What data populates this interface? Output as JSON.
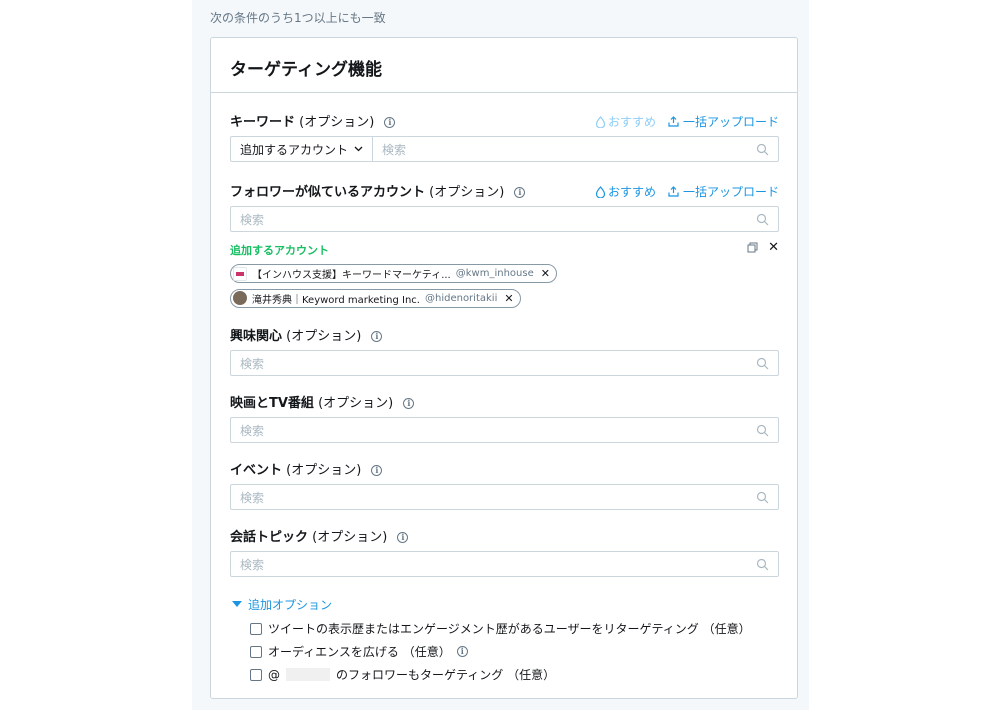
{
  "condition_text": "次の条件のうち1つ以上にも一致",
  "card": {
    "title": "ターゲティング機能"
  },
  "common": {
    "optional": "(オプション)",
    "info": "i",
    "search_placeholder": "検索",
    "recommend": "おすすめ",
    "bulk_upload": "一括アップロード"
  },
  "keywords": {
    "label": "キーワード",
    "dropdown": "追加するアカウント"
  },
  "similar_followers": {
    "label": "フォロワーが似ているアカウント",
    "added_title": "追加するアカウント",
    "chips": [
      {
        "name": "【インハウス支援】キーワードマーケティ...",
        "handle": "@kwm_inhouse",
        "remove": "✕"
      },
      {
        "name": "滝井秀典｜Keyword marketing Inc.",
        "handle": "@hidenoritakii",
        "remove": "✕"
      }
    ],
    "clear_all": "✕"
  },
  "interests": {
    "label": "興味関心"
  },
  "movies_tv": {
    "label": "映画とTV番組"
  },
  "events": {
    "label": "イベント"
  },
  "conversation": {
    "label": "会話トピック"
  },
  "additional_options": {
    "title": "追加オプション",
    "options": [
      {
        "label": "ツイートの表示歴またはエンゲージメント歴があるユーザーをリターゲティング （任意）"
      },
      {
        "label": "オーディエンスを広げる （任意）"
      },
      {
        "prefix": "@",
        "label": "のフォロワーもターゲティング （任意）"
      }
    ]
  },
  "colors": {
    "accent": "#1b95e0",
    "added_green": "#17bf63",
    "border": "#ccd6dd"
  }
}
